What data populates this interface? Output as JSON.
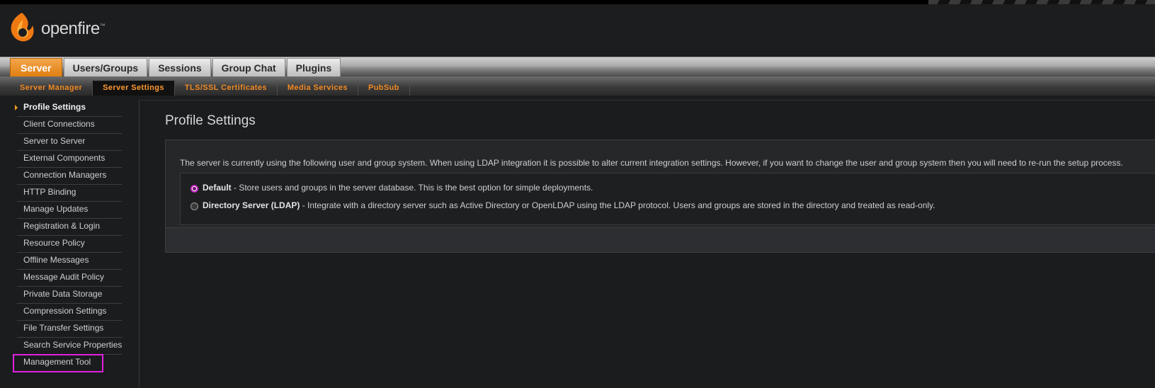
{
  "header": {
    "logo_text": "openfire",
    "logo_tm": "™"
  },
  "main_tabs": [
    {
      "label": "Server",
      "active": true
    },
    {
      "label": "Users/Groups"
    },
    {
      "label": "Sessions"
    },
    {
      "label": "Group Chat"
    },
    {
      "label": "Plugins"
    }
  ],
  "sub_tabs": [
    {
      "label": "Server Manager"
    },
    {
      "label": "Server Settings",
      "active": true
    },
    {
      "label": "TLS/SSL Certificates"
    },
    {
      "label": "Media Services"
    },
    {
      "label": "PubSub"
    }
  ],
  "sidebar": {
    "items": [
      {
        "label": "Profile Settings",
        "active": true
      },
      {
        "label": "Client Connections"
      },
      {
        "label": "Server to Server"
      },
      {
        "label": "External Components"
      },
      {
        "label": "Connection Managers"
      },
      {
        "label": "HTTP Binding"
      },
      {
        "label": "Manage Updates"
      },
      {
        "label": "Registration & Login"
      },
      {
        "label": "Resource Policy"
      },
      {
        "label": "Offline Messages"
      },
      {
        "label": "Message Audit Policy"
      },
      {
        "label": "Private Data Storage"
      },
      {
        "label": "Compression Settings"
      },
      {
        "label": "File Transfer Settings"
      },
      {
        "label": "Search Service Properties"
      },
      {
        "label": "Management Tool",
        "highlighted": true
      }
    ]
  },
  "content": {
    "title": "Profile Settings",
    "description": "The server is currently using the following user and group system. When using LDAP integration it is possible to alter current integration settings. However, if you want to change the user and group system then you will need to re-run the setup process.",
    "options": [
      {
        "label": "Default",
        "text": " - Store users and groups in the server database. This is the best option for simple deployments.",
        "checked": true
      },
      {
        "label": "Directory Server (LDAP)",
        "text": " - Integrate with a directory server such as Active Directory or OpenLDAP using the LDAP protocol. Users and groups are stored in the directory and treated as read-only.",
        "checked": false
      }
    ]
  },
  "colors": {
    "accent": "#f08a24",
    "highlight": "#e020e0"
  }
}
